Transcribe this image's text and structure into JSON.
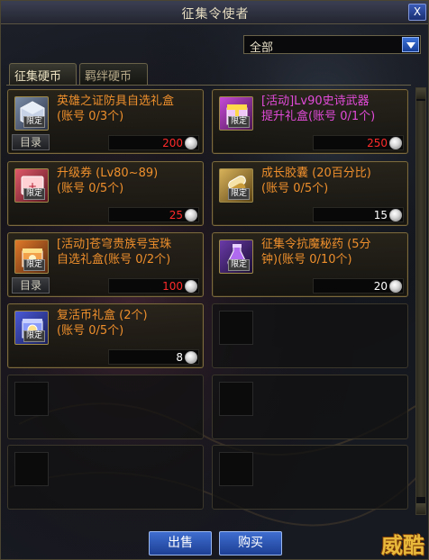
{
  "window": {
    "title": "征集令使者",
    "close_label": "X"
  },
  "filter": {
    "selected": "全部"
  },
  "tabs": [
    {
      "label": "征集硬币",
      "active": true
    },
    {
      "label": "羁绊硬币",
      "active": false
    }
  ],
  "items": [
    {
      "name": "英雄之证防具自选礼盒\n(账号 0/3个)",
      "name_color": "orange",
      "icon": "armor-box-icon",
      "tag": "限定",
      "price": "200",
      "price_color": "red",
      "catalog": "目录"
    },
    {
      "name": "[活动]Lv90史诗武器\n提升礼盒(账号 0/1个)",
      "name_color": "purple",
      "icon": "weapon-box-icon",
      "tag": "限定",
      "price": "250",
      "price_color": "red",
      "catalog": ""
    },
    {
      "name": "升级券 (Lv80~89)\n(账号 0/5个)",
      "name_color": "orange",
      "icon": "ticket-icon",
      "tag": "限定",
      "price": "25",
      "price_color": "red",
      "catalog": ""
    },
    {
      "name": "成长胶囊 (20百分比)\n(账号 0/5个)",
      "name_color": "orange",
      "icon": "capsule-icon",
      "tag": "限定",
      "price": "15",
      "price_color": "white",
      "catalog": ""
    },
    {
      "name": "[活动]苍穹贵族号宝珠\n自选礼盒(账号 0/2个)",
      "name_color": "orange",
      "icon": "orb-box-icon",
      "tag": "限定",
      "price": "100",
      "price_color": "red",
      "catalog": "目录"
    },
    {
      "name": "征集令抗魔秘药 (5分\n钟)(账号 0/10个)",
      "name_color": "orange",
      "icon": "potion-icon",
      "tag": "限定",
      "price": "20",
      "price_color": "white",
      "catalog": ""
    },
    {
      "name": "复活币礼盒 (2个)\n(账号 0/5个)",
      "name_color": "orange",
      "icon": "revival-coin-box-icon",
      "tag": "限定",
      "price": "8",
      "price_color": "white",
      "catalog": ""
    }
  ],
  "buttons": {
    "sell": "出售",
    "buy": "购买"
  },
  "watermark": "威酷",
  "colors": {
    "accent_blue": "#2a56c0",
    "name_orange": "#ee8f2c",
    "name_purple": "#e24bd9",
    "price_red": "#ff2a2a",
    "frame_gold": "#7a6a3e"
  }
}
